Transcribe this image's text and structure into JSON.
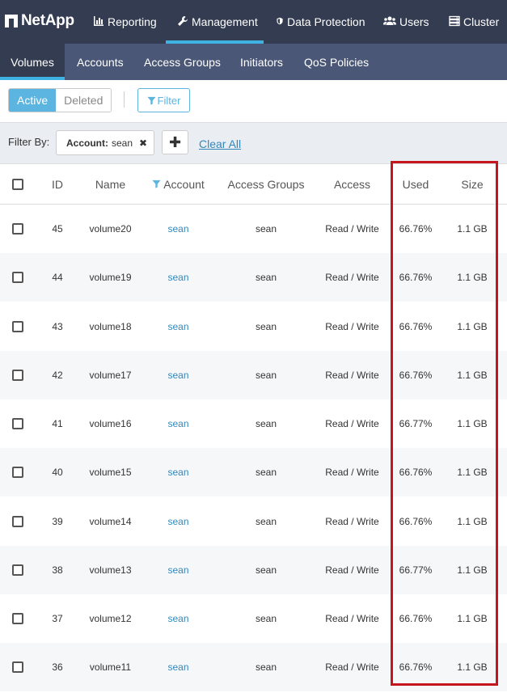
{
  "brand": {
    "name": "NetApp"
  },
  "top_nav": [
    {
      "label": "Reporting",
      "icon": "bar-chart-icon",
      "active": false
    },
    {
      "label": "Management",
      "icon": "wrench-icon",
      "active": true
    },
    {
      "label": "Data Protection",
      "icon": "shield-icon",
      "active": false
    },
    {
      "label": "Users",
      "icon": "users-icon",
      "active": false
    },
    {
      "label": "Cluster",
      "icon": "server-icon",
      "active": false
    }
  ],
  "sub_nav": [
    {
      "label": "Volumes",
      "active": true
    },
    {
      "label": "Accounts",
      "active": false
    },
    {
      "label": "Access Groups",
      "active": false
    },
    {
      "label": "Initiators",
      "active": false
    },
    {
      "label": "QoS Policies",
      "active": false
    }
  ],
  "toolbar": {
    "active_label": "Active",
    "deleted_label": "Deleted",
    "filter_label": "Filter"
  },
  "filter_bar": {
    "label": "Filter By:",
    "chip_key": "Account:",
    "chip_value": "sean",
    "add_label": "✚",
    "clear_label": "Clear All"
  },
  "table": {
    "columns": [
      "ID",
      "Name",
      "Account",
      "Access Groups",
      "Access",
      "Used",
      "Size"
    ],
    "rows": [
      {
        "id": "45",
        "name": "volume20",
        "account": "sean",
        "access_groups": "sean",
        "access": "Read / Write",
        "used": "66.76%",
        "size": "1.1 GB"
      },
      {
        "id": "44",
        "name": "volume19",
        "account": "sean",
        "access_groups": "sean",
        "access": "Read / Write",
        "used": "66.76%",
        "size": "1.1 GB"
      },
      {
        "id": "43",
        "name": "volume18",
        "account": "sean",
        "access_groups": "sean",
        "access": "Read / Write",
        "used": "66.76%",
        "size": "1.1 GB"
      },
      {
        "id": "42",
        "name": "volume17",
        "account": "sean",
        "access_groups": "sean",
        "access": "Read / Write",
        "used": "66.76%",
        "size": "1.1 GB"
      },
      {
        "id": "41",
        "name": "volume16",
        "account": "sean",
        "access_groups": "sean",
        "access": "Read / Write",
        "used": "66.77%",
        "size": "1.1 GB"
      },
      {
        "id": "40",
        "name": "volume15",
        "account": "sean",
        "access_groups": "sean",
        "access": "Read / Write",
        "used": "66.76%",
        "size": "1.1 GB"
      },
      {
        "id": "39",
        "name": "volume14",
        "account": "sean",
        "access_groups": "sean",
        "access": "Read / Write",
        "used": "66.76%",
        "size": "1.1 GB"
      },
      {
        "id": "38",
        "name": "volume13",
        "account": "sean",
        "access_groups": "sean",
        "access": "Read / Write",
        "used": "66.77%",
        "size": "1.1 GB"
      },
      {
        "id": "37",
        "name": "volume12",
        "account": "sean",
        "access_groups": "sean",
        "access": "Read / Write",
        "used": "66.76%",
        "size": "1.1 GB"
      },
      {
        "id": "36",
        "name": "volume11",
        "account": "sean",
        "access_groups": "sean",
        "access": "Read / Write",
        "used": "66.76%",
        "size": "1.1 GB"
      }
    ]
  },
  "colors": {
    "topbar": "#343c52",
    "subbar": "#4a5776",
    "accent": "#3fb2e3",
    "link": "#3387b8",
    "highlight": "#c4161c"
  }
}
